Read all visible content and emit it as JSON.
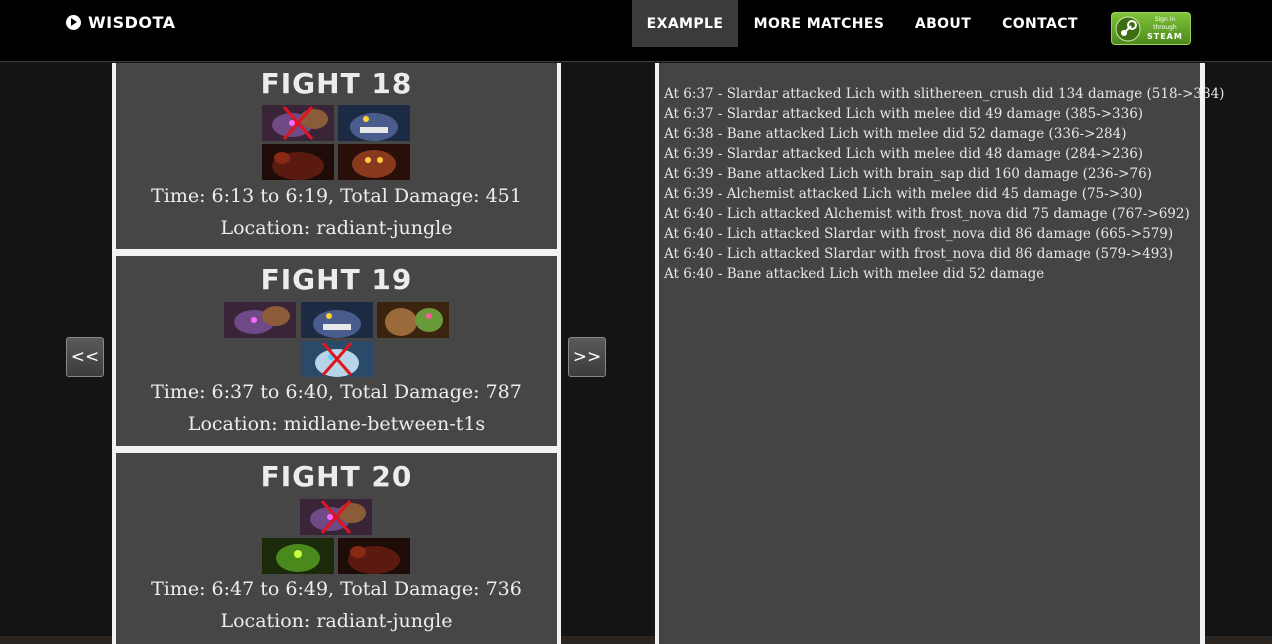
{
  "navbar": {
    "brand": "WISDOTA",
    "items": [
      {
        "label": "EXAMPLE",
        "active": true
      },
      {
        "label": "MORE MATCHES",
        "active": false
      },
      {
        "label": "ABOUT",
        "active": false
      },
      {
        "label": "CONTACT",
        "active": false
      }
    ],
    "steam_button": {
      "small_line1": "Sign in",
      "small_line2": "through",
      "big": "STEAM"
    }
  },
  "pager": {
    "prev_label": "<<",
    "next_label": ">>"
  },
  "fights": [
    {
      "title": "FIGHT 18",
      "time": "Time: 6:13 to 6:19, Total Damage: 451",
      "location": "Location: radiant-jungle",
      "heroes": [
        {
          "name": "bane",
          "dead": true
        },
        {
          "name": "slardar",
          "dead": false
        },
        {
          "name": "lion",
          "dead": false
        },
        {
          "name": "alchemist",
          "dead": false
        }
      ]
    },
    {
      "title": "FIGHT 19",
      "time": "Time: 6:37 to 6:40, Total Damage: 787",
      "location": "Location: midlane-between-t1s",
      "heroes": [
        {
          "name": "bane",
          "dead": false
        },
        {
          "name": "slardar",
          "dead": false
        },
        {
          "name": "alchemist",
          "dead": false
        },
        {
          "name": "lich",
          "dead": true
        }
      ]
    },
    {
      "title": "FIGHT 20",
      "time": "Time: 6:47 to 6:49, Total Damage: 736",
      "location": "Location: radiant-jungle",
      "heroes": [
        {
          "name": "bane",
          "dead": true
        },
        {
          "name": "venomancer",
          "dead": false
        },
        {
          "name": "lion",
          "dead": false
        }
      ]
    }
  ],
  "log": [
    "At 6:37 - Slardar attacked Lich with slithereen_crush did 134 damage (518->384)",
    "At 6:37 - Slardar attacked Lich with melee did 49 damage (385->336)",
    "At 6:38 - Bane attacked Lich with melee did 52 damage (336->284)",
    "At 6:39 - Slardar attacked Lich with melee did 48 damage (284->236)",
    "At 6:39 - Bane attacked Lich with brain_sap did 160 damage (236->76)",
    "At 6:39 - Alchemist attacked Lich with melee did 45 damage (75->30)",
    "At 6:40 - Lich attacked Alchemist with frost_nova did 75 damage (767->692)",
    "At 6:40 - Lich attacked Slardar with frost_nova did 86 damage (665->579)",
    "At 6:40 - Lich attacked Slardar with frost_nova did 86 damage (579->493)",
    "At 6:40 - Bane attacked Lich with melee did 52 damage"
  ],
  "colors": {
    "navbar_bg": "#000000",
    "active_nav_bg": "#3b3b3b",
    "card_bg": "#464646",
    "log_bg": "#444444",
    "dead_mark": "#e0141e",
    "steam_green": "#6aaa2c"
  }
}
